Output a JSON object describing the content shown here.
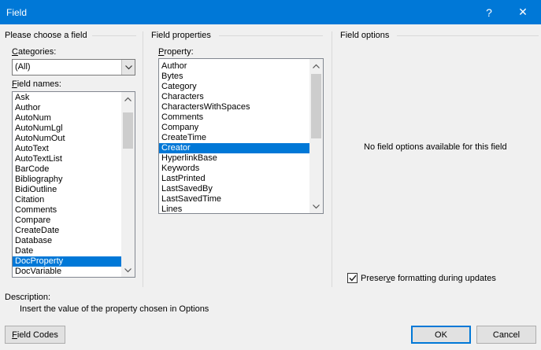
{
  "window": {
    "title": "Field",
    "help_glyph": "?",
    "close_glyph": "✕"
  },
  "left_panel": {
    "heading": "Please choose a field",
    "categories_label_key": "C",
    "categories_label_rest": "ategories:",
    "categories_value": "(All)",
    "field_names_label_key": "F",
    "field_names_label_rest": "ield names:",
    "field_names": [
      "Ask",
      "Author",
      "AutoNum",
      "AutoNumLgl",
      "AutoNumOut",
      "AutoText",
      "AutoTextList",
      "BarCode",
      "Bibliography",
      "BidiOutline",
      "Citation",
      "Comments",
      "Compare",
      "CreateDate",
      "Database",
      "Date",
      "DocProperty",
      "DocVariable"
    ],
    "selected_field": "DocProperty"
  },
  "middle_panel": {
    "heading": "Field properties",
    "property_label_key": "P",
    "property_label_rest": "roperty:",
    "properties": [
      "Author",
      "Bytes",
      "Category",
      "Characters",
      "CharactersWithSpaces",
      "Comments",
      "Company",
      "CreateTime",
      "Creator",
      "HyperlinkBase",
      "Keywords",
      "LastPrinted",
      "LastSavedBy",
      "LastSavedTime",
      "Lines"
    ],
    "selected_property": "Creator"
  },
  "right_panel": {
    "heading": "Field options",
    "empty_message": "No field options available for this field",
    "preserve_pre": "Preser",
    "preserve_key": "v",
    "preserve_post": "e formatting during updates",
    "preserve_checked": true
  },
  "description": {
    "label": "Description:",
    "text": "Insert the value of the property chosen in Options"
  },
  "buttons": {
    "field_codes_key": "F",
    "field_codes_rest": "ield Codes",
    "ok": "OK",
    "cancel": "Cancel"
  },
  "colors": {
    "accent": "#0078d7",
    "dialog_bg": "#f0f0f0"
  }
}
